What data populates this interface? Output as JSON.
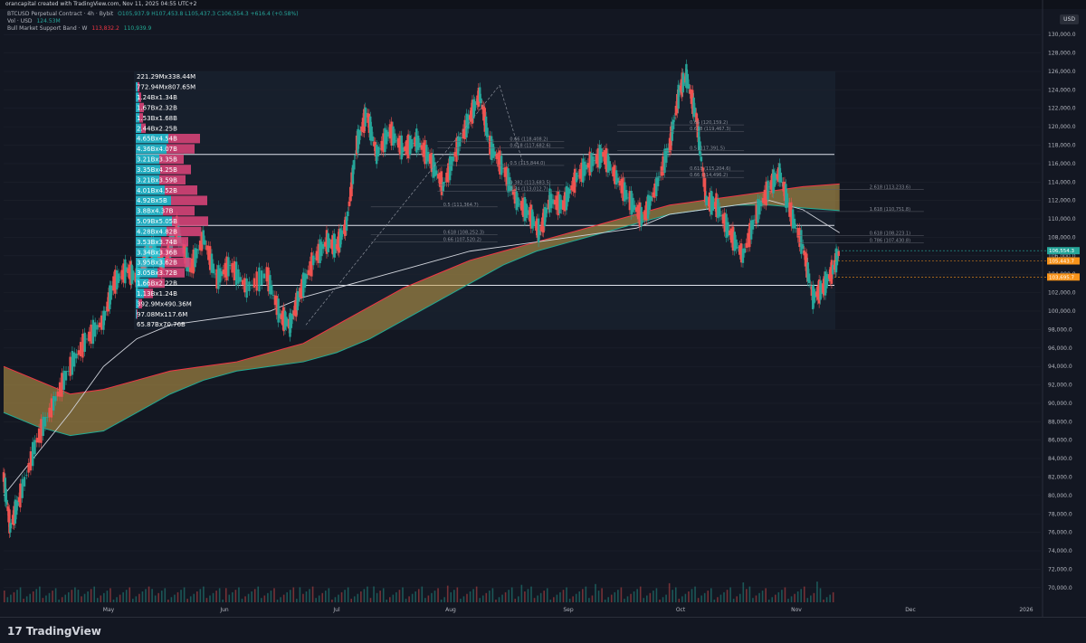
{
  "header": {
    "credit": "orancapital created with TradingView.com, Nov 11, 2025 04:55 UTC+2"
  },
  "legend": {
    "symbol": "BTCUSD Perpetual Contract · 4h · Bybit",
    "ohlc": "O105,937.9  H107,453.8  L105,437.3  C106,554.3  +616.4 (+0.58%)",
    "vol_label": "Vol · USD",
    "vol_value": "124.53M",
    "band_label": "Bull Market Support Band · W",
    "band_v1": "113,832.2",
    "band_v2": "110,939.9"
  },
  "currency_button": "USD",
  "brand": {
    "name": "TradingView",
    "mark": "17"
  },
  "chart_data": {
    "type": "line",
    "title": "",
    "x_months": [
      "May",
      "Jun",
      "Jul",
      "Aug",
      "Sep",
      "Oct",
      "Nov",
      "Dec",
      "2026"
    ],
    "y_ticks": [
      70000,
      72000,
      74000,
      76000,
      78000,
      80000,
      82000,
      84000,
      86000,
      88000,
      90000,
      92000,
      94000,
      96000,
      98000,
      100000,
      102000,
      104000,
      106000,
      108000,
      110000,
      112000,
      114000,
      116000,
      118000,
      120000,
      122000,
      124000,
      126000,
      128000,
      130000
    ],
    "ylim": [
      69000,
      131000
    ],
    "price_path": [
      [
        0,
        82000
      ],
      [
        0.2,
        76500
      ],
      [
        0.5,
        80000
      ],
      [
        1.0,
        86000
      ],
      [
        1.5,
        90000
      ],
      [
        2.0,
        94000
      ],
      [
        2.5,
        97000
      ],
      [
        3.0,
        99000
      ],
      [
        3.3,
        103000
      ],
      [
        3.7,
        104500
      ],
      [
        4.0,
        103500
      ],
      [
        4.4,
        107000
      ],
      [
        4.8,
        105000
      ],
      [
        5.2,
        109000
      ],
      [
        5.6,
        104500
      ],
      [
        6.0,
        108000
      ],
      [
        6.4,
        103500
      ],
      [
        6.8,
        105000
      ],
      [
        7.3,
        102500
      ],
      [
        7.9,
        104000
      ],
      [
        8.3,
        99500
      ],
      [
        8.6,
        98500
      ],
      [
        8.9,
        102000
      ],
      [
        9.3,
        105500
      ],
      [
        9.7,
        107500
      ],
      [
        10.0,
        107000
      ],
      [
        10.3,
        109500
      ],
      [
        10.6,
        118000
      ],
      [
        10.9,
        121500
      ],
      [
        11.2,
        117000
      ],
      [
        11.6,
        119500
      ],
      [
        12.0,
        117500
      ],
      [
        12.4,
        118500
      ],
      [
        12.8,
        116500
      ],
      [
        13.2,
        113500
      ],
      [
        13.6,
        117500
      ],
      [
        14.0,
        121000
      ],
      [
        14.3,
        123500
      ],
      [
        14.6,
        118000
      ],
      [
        15.0,
        115500
      ],
      [
        15.4,
        112000
      ],
      [
        15.8,
        110500
      ],
      [
        16.1,
        108500
      ],
      [
        16.4,
        112000
      ],
      [
        16.8,
        111500
      ],
      [
        17.2,
        114500
      ],
      [
        17.6,
        116000
      ],
      [
        18.0,
        117000
      ],
      [
        18.4,
        114500
      ],
      [
        18.8,
        112000
      ],
      [
        19.2,
        110000
      ],
      [
        19.6,
        113500
      ],
      [
        20.0,
        118000
      ],
      [
        20.3,
        124000
      ],
      [
        20.5,
        125500
      ],
      [
        20.8,
        121000
      ],
      [
        21.1,
        112000
      ],
      [
        21.4,
        111500
      ],
      [
        21.8,
        108500
      ],
      [
        22.2,
        106000
      ],
      [
        22.6,
        110500
      ],
      [
        23.0,
        113500
      ],
      [
        23.3,
        115000
      ],
      [
        23.6,
        111000
      ],
      [
        24.0,
        107000
      ],
      [
        24.3,
        101500
      ],
      [
        24.6,
        102500
      ],
      [
        24.9,
        104500
      ],
      [
        25.1,
        106500
      ]
    ],
    "sma_path": [
      [
        0,
        80000
      ],
      [
        1.0,
        84500
      ],
      [
        2.0,
        89000
      ],
      [
        3.0,
        94000
      ],
      [
        4.0,
        97000
      ],
      [
        5.0,
        98500
      ],
      [
        6.0,
        99000
      ],
      [
        7.0,
        99500
      ],
      [
        8.0,
        100000
      ],
      [
        9.0,
        101500
      ],
      [
        10.0,
        102500
      ],
      [
        11.0,
        103500
      ],
      [
        12.0,
        104500
      ],
      [
        13.0,
        105500
      ],
      [
        14.0,
        106500
      ],
      [
        15.0,
        107000
      ],
      [
        16.0,
        107500
      ],
      [
        17.0,
        108000
      ],
      [
        18.0,
        108500
      ],
      [
        19.0,
        109000
      ],
      [
        20.0,
        110500
      ],
      [
        21.0,
        111000
      ],
      [
        22.0,
        111500
      ],
      [
        23.0,
        112000
      ],
      [
        24.0,
        111000
      ],
      [
        25.1,
        108500
      ]
    ],
    "band_upper": [
      [
        0,
        94000
      ],
      [
        1,
        92500
      ],
      [
        2,
        91000
      ],
      [
        3,
        91500
      ],
      [
        4,
        92500
      ],
      [
        5,
        93500
      ],
      [
        6,
        94000
      ],
      [
        7,
        94500
      ],
      [
        8,
        95500
      ],
      [
        9,
        96500
      ],
      [
        10,
        98500
      ],
      [
        11,
        100500
      ],
      [
        12,
        102500
      ],
      [
        13,
        104000
      ],
      [
        14,
        105500
      ],
      [
        15,
        106500
      ],
      [
        16,
        107500
      ],
      [
        17,
        108500
      ],
      [
        18,
        109500
      ],
      [
        19,
        110500
      ],
      [
        20,
        111500
      ],
      [
        21,
        112000
      ],
      [
        22,
        112500
      ],
      [
        23,
        113000
      ],
      [
        24,
        113500
      ],
      [
        25.1,
        113800
      ]
    ],
    "band_lower": [
      [
        0,
        89000
      ],
      [
        1,
        87500
      ],
      [
        2,
        86500
      ],
      [
        3,
        87000
      ],
      [
        4,
        89000
      ],
      [
        5,
        91000
      ],
      [
        6,
        92500
      ],
      [
        7,
        93500
      ],
      [
        8,
        94000
      ],
      [
        9,
        94500
      ],
      [
        10,
        95500
      ],
      [
        11,
        97000
      ],
      [
        12,
        99000
      ],
      [
        13,
        101000
      ],
      [
        14,
        103000
      ],
      [
        15,
        105000
      ],
      [
        16,
        106500
      ],
      [
        17,
        107500
      ],
      [
        18,
        108500
      ],
      [
        19,
        109500
      ],
      [
        20,
        110500
      ],
      [
        21,
        111000
      ],
      [
        22,
        111500
      ],
      [
        23,
        111500
      ],
      [
        24,
        111200
      ],
      [
        25.1,
        110900
      ]
    ],
    "horizontal_levels": [
      117000,
      109300,
      102800
    ],
    "volume_profile": [
      {
        "label": "221.29Mx338.44M",
        "teal": 0,
        "pink": 0
      },
      {
        "label": "772.94Mx807.65M",
        "teal": 2,
        "pink": 2
      },
      {
        "label": "1.24Bx1.34B",
        "teal": 3,
        "pink": 3
      },
      {
        "label": "1.67Bx2.32B",
        "teal": 4,
        "pink": 5
      },
      {
        "label": "1.53Bx1.68B",
        "teal": 4,
        "pink": 4
      },
      {
        "label": "2.44Bx2.25B",
        "teal": 6,
        "pink": 5
      },
      {
        "label": "4.65Bx4.54B",
        "teal": 36,
        "pink": 35
      },
      {
        "label": "4.36Bx4.07B",
        "teal": 34,
        "pink": 31
      },
      {
        "label": "3.21Bx3.35B",
        "teal": 26,
        "pink": 27
      },
      {
        "label": "3.35Bx4.25B",
        "teal": 27,
        "pink": 34
      },
      {
        "label": "3.21Bx3.59B",
        "teal": 26,
        "pink": 29
      },
      {
        "label": "4.01Bx4.52B",
        "teal": 32,
        "pink": 36
      },
      {
        "label": "4.92Bx5B",
        "teal": 39,
        "pink": 40
      },
      {
        "label": "3.8Bx4.37B",
        "teal": 30,
        "pink": 35
      },
      {
        "label": "5.09Bx5.05B",
        "teal": 40,
        "pink": 40
      },
      {
        "label": "4.28Bx4.82B",
        "teal": 34,
        "pink": 38
      },
      {
        "label": "3.53Bx3.74B",
        "teal": 28,
        "pink": 30
      },
      {
        "label": "3.34Bx3.36B",
        "teal": 27,
        "pink": 27
      },
      {
        "label": "3.95Bx3.62B",
        "teal": 32,
        "pink": 29
      },
      {
        "label": "3.05Bx3.72B",
        "teal": 24,
        "pink": 30
      },
      {
        "label": "1.66Bx2.22B",
        "teal": 14,
        "pink": 18
      },
      {
        "label": "1.13Bx1.24B",
        "teal": 9,
        "pink": 10
      },
      {
        "label": "392.9Mx490.36M",
        "teal": 3,
        "pink": 4
      },
      {
        "label": "97.08Mx117.6M",
        "teal": 1,
        "pink": 1
      },
      {
        "label": "65.87Bx70.76B",
        "teal": 0,
        "pink": 0
      }
    ],
    "fib_labels": [
      {
        "text": "0.66 (118,408.2)",
        "price": 118400,
        "xi": 15.2
      },
      {
        "text": "0.618 (117,682.6)",
        "price": 117700,
        "xi": 15.2
      },
      {
        "text": "0.5 (115,844.0)",
        "price": 115800,
        "xi": 15.2
      },
      {
        "text": "0.382 (113,683.5)",
        "price": 113700,
        "xi": 15.2
      },
      {
        "text": "0.34 (113,012.7)",
        "price": 113000,
        "xi": 15.2
      },
      {
        "text": "0.5 (111,364.7)",
        "price": 111300,
        "xi": 13.2
      },
      {
        "text": "0.618 (108,252.3)",
        "price": 108300,
        "xi": 13.2
      },
      {
        "text": "0.66 (107,520.2)",
        "price": 107500,
        "xi": 13.2
      },
      {
        "text": "0.66 (120,159.2)",
        "price": 120200,
        "xi": 20.6
      },
      {
        "text": "0.618 (119,467.3)",
        "price": 119500,
        "xi": 20.6
      },
      {
        "text": "0.5 (117,391.5)",
        "price": 117400,
        "xi": 20.6
      },
      {
        "text": "0.618 (115,204.6)",
        "price": 115200,
        "xi": 20.6
      },
      {
        "text": "0.66 (114,496.2)",
        "price": 114500,
        "xi": 20.6
      },
      {
        "text": "2.618 (113,233.6)",
        "price": 113200,
        "xi": 26.0
      },
      {
        "text": "1.618 (110,751.8)",
        "price": 110800,
        "xi": 26.0
      },
      {
        "text": "0.618 (108,223.1)",
        "price": 108200,
        "xi": 26.0
      },
      {
        "text": "0.786 (107,430.8)",
        "price": 107400,
        "xi": 26.0
      }
    ],
    "price_tags": [
      {
        "text": "106,554.3",
        "price": 106554,
        "color": "#26a69a"
      },
      {
        "text": "105,443.7",
        "price": 105444,
        "color": "#f7931a"
      },
      {
        "text": "103,695.7",
        "price": 103696,
        "color": "#f7931a"
      }
    ]
  }
}
